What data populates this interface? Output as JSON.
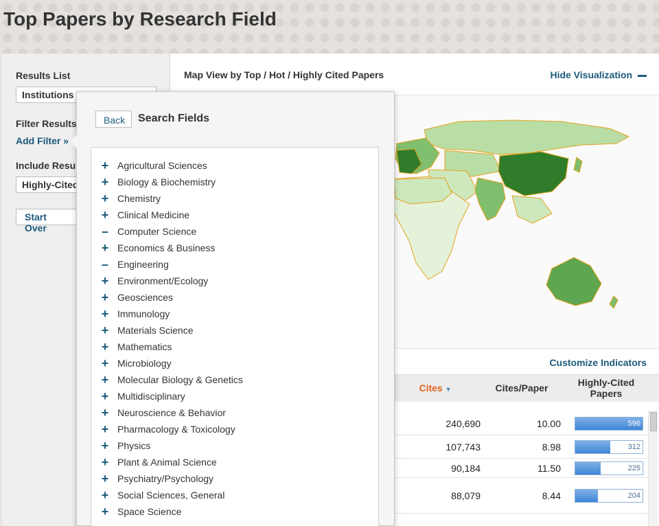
{
  "page": {
    "title": "Top Papers by Research Field"
  },
  "left_panel": {
    "results_list_label": "Results List",
    "results_list_value": "Institutions",
    "filter_label": "Filter Results By",
    "add_filter": "Add Filter »",
    "include_label": "Include Results For",
    "include_value": "Highly-Cited Papers",
    "start_over": "Start Over"
  },
  "main": {
    "map_title": "Map View by Top / Hot / Highly Cited Papers",
    "hide_visualization": "Hide Visualization",
    "customize_indicators": "Customize Indicators"
  },
  "table": {
    "headers": {
      "cites": "Cites",
      "cites_per_paper": "Cites/Paper",
      "highly_cited": "Highly-Cited\nPapers"
    },
    "rows": [
      {
        "cites": "240,690",
        "cites_per_paper": "10.00",
        "highly_cited": "596",
        "fill": 1.0
      },
      {
        "cites": "107,743",
        "cites_per_paper": "8.98",
        "highly_cited": "312",
        "fill": 0.52
      },
      {
        "cites": "90,184",
        "cites_per_paper": "11.50",
        "highly_cited": "225",
        "fill": 0.38
      },
      {
        "cites": "88,079",
        "cites_per_paper": "8.44",
        "highly_cited": "204",
        "fill": 0.34
      }
    ]
  },
  "popup": {
    "back": "Back",
    "title": "Search Fields",
    "fields": [
      {
        "label": "Agricultural Sciences",
        "icon": "plus"
      },
      {
        "label": "Biology & Biochemistry",
        "icon": "plus"
      },
      {
        "label": "Chemistry",
        "icon": "plus"
      },
      {
        "label": "Clinical Medicine",
        "icon": "plus"
      },
      {
        "label": "Computer Science",
        "icon": "minus"
      },
      {
        "label": "Economics & Business",
        "icon": "plus"
      },
      {
        "label": "Engineering",
        "icon": "minus"
      },
      {
        "label": "Environment/Ecology",
        "icon": "plus"
      },
      {
        "label": "Geosciences",
        "icon": "plus"
      },
      {
        "label": "Immunology",
        "icon": "plus"
      },
      {
        "label": "Materials Science",
        "icon": "plus"
      },
      {
        "label": "Mathematics",
        "icon": "plus"
      },
      {
        "label": "Microbiology",
        "icon": "plus"
      },
      {
        "label": "Molecular Biology & Genetics",
        "icon": "plus"
      },
      {
        "label": "Multidisciplinary",
        "icon": "plus"
      },
      {
        "label": "Neuroscience & Behavior",
        "icon": "plus"
      },
      {
        "label": "Pharmacology & Toxicology",
        "icon": "plus"
      },
      {
        "label": "Physics",
        "icon": "plus"
      },
      {
        "label": "Plant & Animal Science",
        "icon": "plus"
      },
      {
        "label": "Psychiatry/Psychology",
        "icon": "plus"
      },
      {
        "label": "Social Sciences, General",
        "icon": "plus"
      },
      {
        "label": "Space Science",
        "icon": "plus"
      }
    ]
  },
  "colors": {
    "link": "#1d5a7a",
    "accent": "#e0651c",
    "map_dark": "#2f7d2a",
    "map_light": "#b9dea5"
  }
}
